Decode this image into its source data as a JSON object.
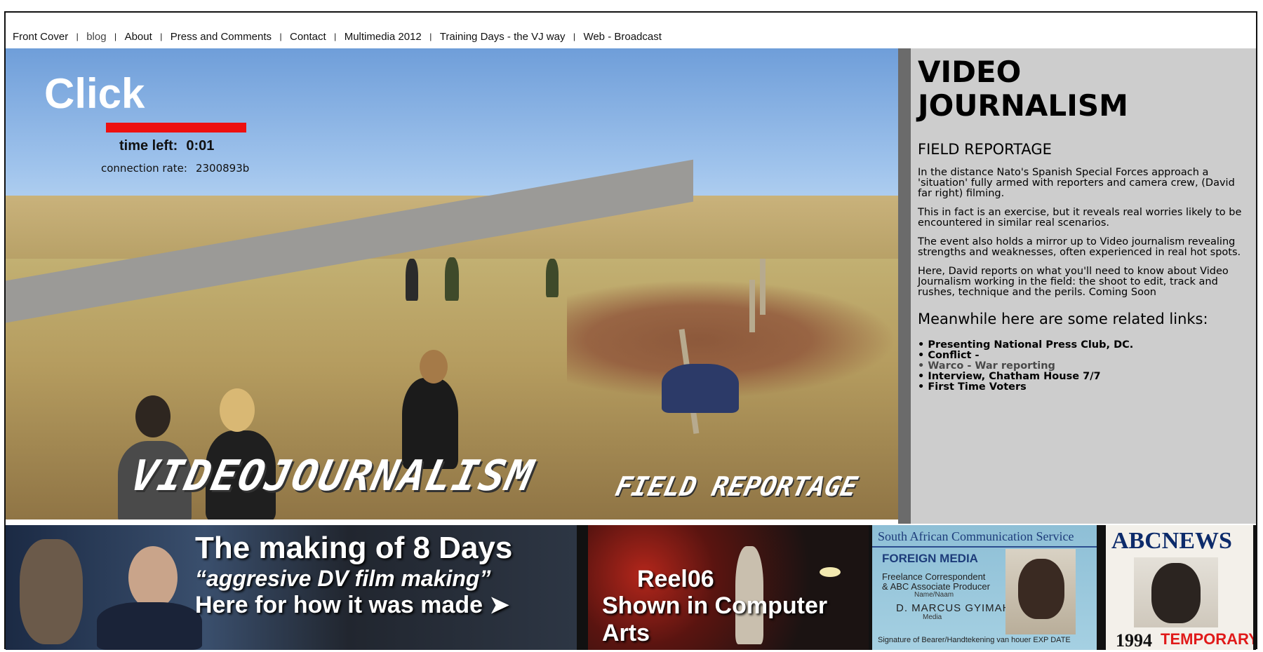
{
  "nav": {
    "items": [
      {
        "label": "Front Cover"
      },
      {
        "label": "blog"
      },
      {
        "label": "About"
      },
      {
        "label": "Press and Comments"
      },
      {
        "label": "Contact"
      },
      {
        "label": "Multimedia 2012"
      },
      {
        "label": "Training Days - the VJ way"
      },
      {
        "label": "Web - Broadcast"
      }
    ],
    "separator": "|"
  },
  "hero": {
    "click_label": "Click",
    "progress_fraction": 1.0,
    "progress_color": "#ee1010",
    "time_left_label": "time left:",
    "time_left_value": "0:01",
    "connection_label": "connection rate:",
    "connection_value": "2300893b",
    "title": "VIDEOJOURNALISM",
    "subtitle": "FIELD REPORTAGE"
  },
  "sidebar": {
    "title_line1": "VIDEO",
    "title_line2": "JOURNALISM",
    "subtitle": "FIELD REPORTAGE",
    "paragraphs": [
      "In the distance Nato's Spanish Special Forces approach a 'situation' fully armed with reporters and camera crew, (David far right) filming.",
      "This in fact is an exercise, but it reveals real worries likely to be encountered in similar real scenarios.",
      "The event also holds a mirror up to Video journalism revealing strengths and weaknesses, often experienced in real hot spots.",
      "Here, David reports on what you'll need to know about Video Journalism working in the field: the shoot to edit, track and rushes, technique and the perils. Coming Soon"
    ],
    "links_heading": "Meanwhile here are some related links:",
    "links": [
      {
        "label": "• Presenting National Press Club, DC."
      },
      {
        "label": "• Conflict -"
      },
      {
        "label": "• Warco - War reporting"
      },
      {
        "label": "• Interview, Chatham House 7/7"
      },
      {
        "label": "• First Time Voters"
      }
    ]
  },
  "strip": {
    "promo1": {
      "line1": "The making of 8 Days",
      "line2": "“aggresive DV film making”",
      "line3": "Here for how it was made ➤"
    },
    "promo2": {
      "line1": "Reel06",
      "line2": "Shown in Computer Arts"
    },
    "card": {
      "org": "South African Communication Service",
      "foreign_media": "FOREIGN MEDIA",
      "role1": "Freelance Correspondent",
      "role2": "& ABC Associate Producer",
      "name_label": "Name/Naam",
      "name": "D. MARCUS GYIMAH",
      "media_label": "Media",
      "signature_line": "Signature of Bearer/Handtekening van houer  EXP DATE"
    },
    "abc": {
      "logo": "ABCNEWS",
      "year": "1994",
      "temp": "TEMPORARY"
    }
  },
  "colors": {
    "sidebar_bg": "#cdcdcd",
    "sidebar_border": "#6b6b6b",
    "accent_red": "#ee1010"
  }
}
